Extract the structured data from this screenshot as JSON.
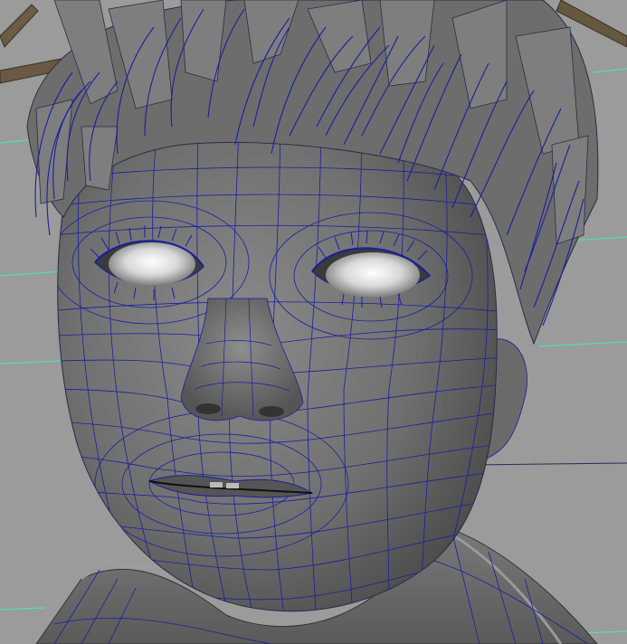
{
  "viewport": {
    "background": "#9b9b9b",
    "wire_color": "#1a1f9e",
    "grid_line_color": "#4fe0b2",
    "shading_color": "#6e6e6e"
  },
  "objects": [
    {
      "name": "head",
      "shading": "smooth-shade-wireframe-on-shaded",
      "selected": true
    },
    {
      "name": "hair",
      "shading": "smooth-shade-wireframe-on-shaded",
      "selected": true
    },
    {
      "name": "eyes",
      "shading": "smooth-shade",
      "selected": false
    },
    {
      "name": "shirt",
      "shading": "smooth-shade",
      "selected": false
    },
    {
      "name": "branch",
      "shading": "smooth-shade",
      "selected": false
    }
  ]
}
